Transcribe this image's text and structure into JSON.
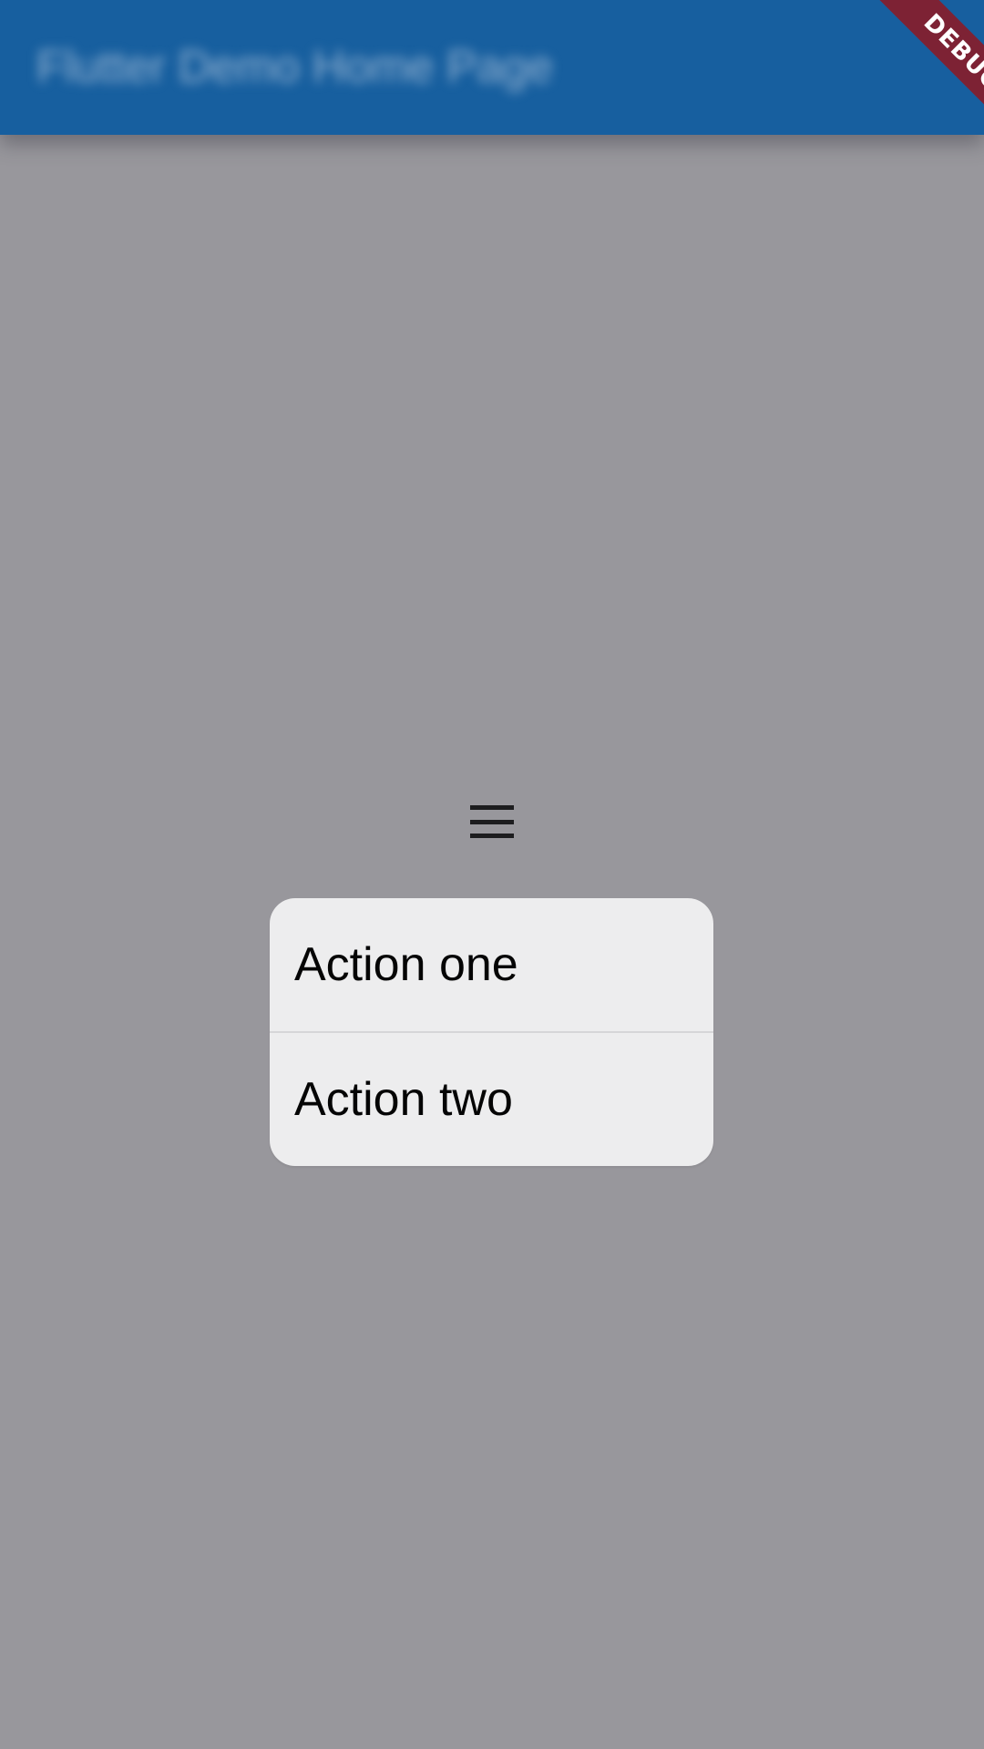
{
  "app_bar": {
    "title": "Flutter Demo Home Page",
    "background_color": "#175f9f"
  },
  "debug_banner": {
    "label": "DEBUG",
    "color": "#7d2234"
  },
  "menu_icon": {
    "icon": "menu-icon"
  },
  "action_sheet": {
    "items": [
      {
        "label": "Action one"
      },
      {
        "label": "Action two"
      }
    ]
  },
  "scrim_color": "#98979c"
}
